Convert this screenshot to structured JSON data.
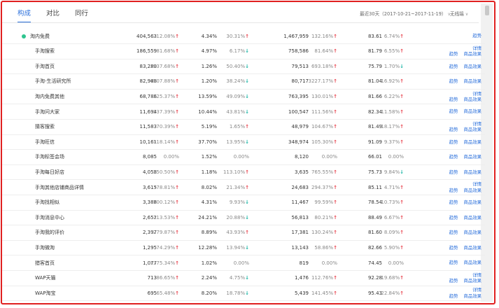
{
  "tabs": [
    {
      "label": "构成",
      "active": true
    },
    {
      "label": "对比",
      "active": false
    },
    {
      "label": "同行",
      "active": false
    }
  ],
  "date_range": "最近30天（2017-10-21~2017-11-19）",
  "terminal": "无线端",
  "ops": {
    "trend": "趋势",
    "detail": "详情",
    "effect": "商品效果"
  },
  "rows": [
    {
      "name": "淘内免费",
      "top": true,
      "c1": "404,563",
      "p1": "212.08%",
      "d1": "up",
      "c2": "4.34%",
      "p2": "30.31%",
      "d2": "up",
      "c3": "1,467,959",
      "p3": "132.16%",
      "d3": "up",
      "c4": "83.61",
      "p4": "6.74%",
      "d4": "up",
      "ops": "trend"
    },
    {
      "name": "手淘搜索",
      "c1": "186,559",
      "p1": "81.68%",
      "d1": "up",
      "c2": "4.97%",
      "p2": "6.17%",
      "d2": "down",
      "c3": "758,586",
      "p3": "81.64%",
      "d3": "up",
      "c4": "81.79",
      "p4": "6.55%",
      "d4": "up",
      "ops": "detail"
    },
    {
      "name": "手淘首页",
      "c1": "83,280",
      "p1": "1937.68%",
      "d1": "up",
      "c2": "1.26%",
      "p2": "50.40%",
      "d2": "down",
      "c3": "79,513",
      "p3": "693.18%",
      "d3": "up",
      "c4": "75.79",
      "p4": "1.70%",
      "d4": "down",
      "ops": "both"
    },
    {
      "name": "手淘-生活研究所",
      "c1": "82,988",
      "p1": "4507.88%",
      "d1": "up",
      "c2": "1.20%",
      "p2": "38.24%",
      "d2": "down",
      "c3": "80,717",
      "p3": "3227.17%",
      "d3": "up",
      "c4": "81.04",
      "p4": "16.92%",
      "d4": "up",
      "ops": "both"
    },
    {
      "name": "淘内免费其他",
      "c1": "68,786",
      "p1": "325.37%",
      "d1": "up",
      "c2": "13.59%",
      "p2": "49.09%",
      "d2": "down",
      "c3": "763,395",
      "p3": "130.01%",
      "d3": "up",
      "c4": "81.66",
      "p4": "6.22%",
      "d4": "up",
      "ops": "detail"
    },
    {
      "name": "手淘问大家",
      "c1": "11,694",
      "p1": "237.39%",
      "d1": "up",
      "c2": "10.44%",
      "p2": "43.81%",
      "d2": "down",
      "c3": "100,547",
      "p3": "111.56%",
      "d3": "up",
      "c4": "82.34",
      "p4": "11.58%",
      "d4": "up",
      "ops": "both"
    },
    {
      "name": "猜客搜索",
      "c1": "11,583",
      "p1": "70.39%",
      "d1": "up",
      "c2": "5.19%",
      "p2": "1.65%",
      "d2": "up",
      "c3": "48,979",
      "p3": "104.67%",
      "d3": "up",
      "c4": "81.49",
      "p4": "18.17%",
      "d4": "up",
      "ops": "detail"
    },
    {
      "name": "手淘旺信",
      "c1": "10,161",
      "p1": "118.14%",
      "d1": "up",
      "c2": "37.70%",
      "p2": "13.95%",
      "d2": "down",
      "c3": "348,974",
      "p3": "105.30%",
      "d3": "up",
      "c4": "91.09",
      "p4": "9.37%",
      "d4": "up",
      "ops": "both"
    },
    {
      "name": "手淘标签会场",
      "c1": "8,085",
      "p1": "0.00%",
      "d1": "none",
      "c2": "1.52%",
      "p2": "0.00%",
      "d2": "none",
      "c3": "8,120",
      "p3": "0.00%",
      "d3": "none",
      "c4": "66.01",
      "p4": "0.00%",
      "d4": "none",
      "ops": "both"
    },
    {
      "name": "手淘每日好店",
      "c1": "4,058",
      "p1": "350.50%",
      "d1": "up",
      "c2": "1.18%",
      "p2": "113.10%",
      "d2": "up",
      "c3": "3,635",
      "p3": "765.55%",
      "d3": "up",
      "c4": "75.73",
      "p4": "9.84%",
      "d4": "down",
      "ops": "both"
    },
    {
      "name": "手淘其他店铺商品详情",
      "c1": "3,615",
      "p1": "378.81%",
      "d1": "up",
      "c2": "8.02%",
      "p2": "21.34%",
      "d2": "up",
      "c3": "24,683",
      "p3": "294.37%",
      "d3": "up",
      "c4": "85.11",
      "p4": "4.71%",
      "d4": "up",
      "ops": "detail"
    },
    {
      "name": "手淘找相似",
      "c1": "3,388",
      "p1": "100.12%",
      "d1": "up",
      "c2": "4.31%",
      "p2": "9.93%",
      "d2": "down",
      "c3": "11,467",
      "p3": "99.59%",
      "d3": "up",
      "c4": "78.54",
      "p4": "10.73%",
      "d4": "up",
      "ops": "both"
    },
    {
      "name": "手淘消息中心",
      "c1": "2,652",
      "p1": "113.53%",
      "d1": "up",
      "c2": "24.21%",
      "p2": "20.88%",
      "d2": "down",
      "c3": "56,813",
      "p3": "80.21%",
      "d3": "up",
      "c4": "88.49",
      "p4": "6.67%",
      "d4": "up",
      "ops": "both"
    },
    {
      "name": "手淘我的评价",
      "c1": "2,397",
      "p1": "279.87%",
      "d1": "up",
      "c2": "8.89%",
      "p2": "43.93%",
      "d2": "up",
      "c3": "17,381",
      "p3": "130.24%",
      "d3": "up",
      "c4": "81.60",
      "p4": "8.09%",
      "d4": "up",
      "ops": "both"
    },
    {
      "name": "手淘微淘",
      "c1": "1,295",
      "p1": "74.29%",
      "d1": "up",
      "c2": "12.28%",
      "p2": "13.94%",
      "d2": "down",
      "c3": "13,143",
      "p3": "58.86%",
      "d3": "up",
      "c4": "82.66",
      "p4": "5.90%",
      "d4": "up",
      "ops": "both"
    },
    {
      "name": "猎客首页",
      "c1": "1,077",
      "p1": "1375.34%",
      "d1": "up",
      "c2": "1.02%",
      "p2": "0.00%",
      "d2": "none",
      "c3": "819",
      "p3": "0.00%",
      "d3": "none",
      "c4": "74.45",
      "p4": "0.00%",
      "d4": "none",
      "ops": "both"
    },
    {
      "name": "WAP天猫",
      "c1": "713",
      "p1": "86.65%",
      "d1": "up",
      "c2": "2.24%",
      "p2": "4.75%",
      "d2": "down",
      "c3": "1,476",
      "p3": "112.76%",
      "d3": "up",
      "c4": "92.28",
      "p4": "19.68%",
      "d4": "up",
      "ops": "detail"
    },
    {
      "name": "WAP淘宝",
      "c1": "695",
      "p1": "65.48%",
      "d1": "up",
      "c2": "8.20%",
      "p2": "18.78%",
      "d2": "down",
      "c3": "5,439",
      "p3": "141.45%",
      "d3": "up",
      "c4": "95.43",
      "p4": "22.84%",
      "d4": "up",
      "ops": "detail"
    }
  ]
}
